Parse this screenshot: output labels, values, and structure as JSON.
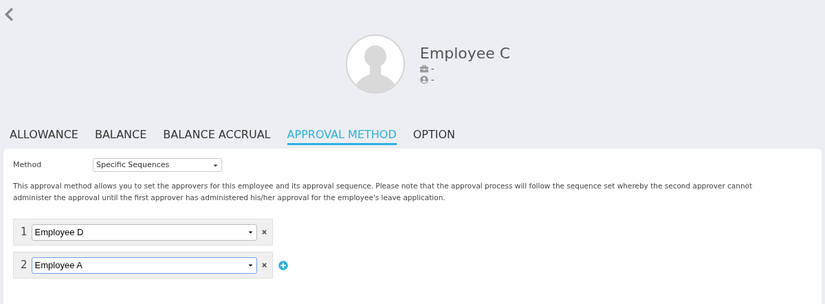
{
  "profile": {
    "name": "Employee C",
    "position": "-",
    "role": "-"
  },
  "tabs": [
    {
      "label": "ALLOWANCE",
      "selected": false
    },
    {
      "label": "BALANCE",
      "selected": false
    },
    {
      "label": "BALANCE ACCRUAL",
      "selected": false
    },
    {
      "label": "APPROVAL METHOD",
      "selected": true
    },
    {
      "label": "OPTION",
      "selected": false
    }
  ],
  "method": {
    "label": "Method",
    "value": "Specific Sequences"
  },
  "description": "This approval method allows you to set the approvers for this employee and its approval sequence. Please note that the approval process will follow the sequence set whereby the second approver cannot administer the approval until the first approver has administered his/her approval for the employee's leave application.",
  "approvers": [
    {
      "number": "1",
      "value": "Employee D",
      "focused": false,
      "can_add": false
    },
    {
      "number": "2",
      "value": "Employee A",
      "focused": true,
      "can_add": true
    }
  ]
}
